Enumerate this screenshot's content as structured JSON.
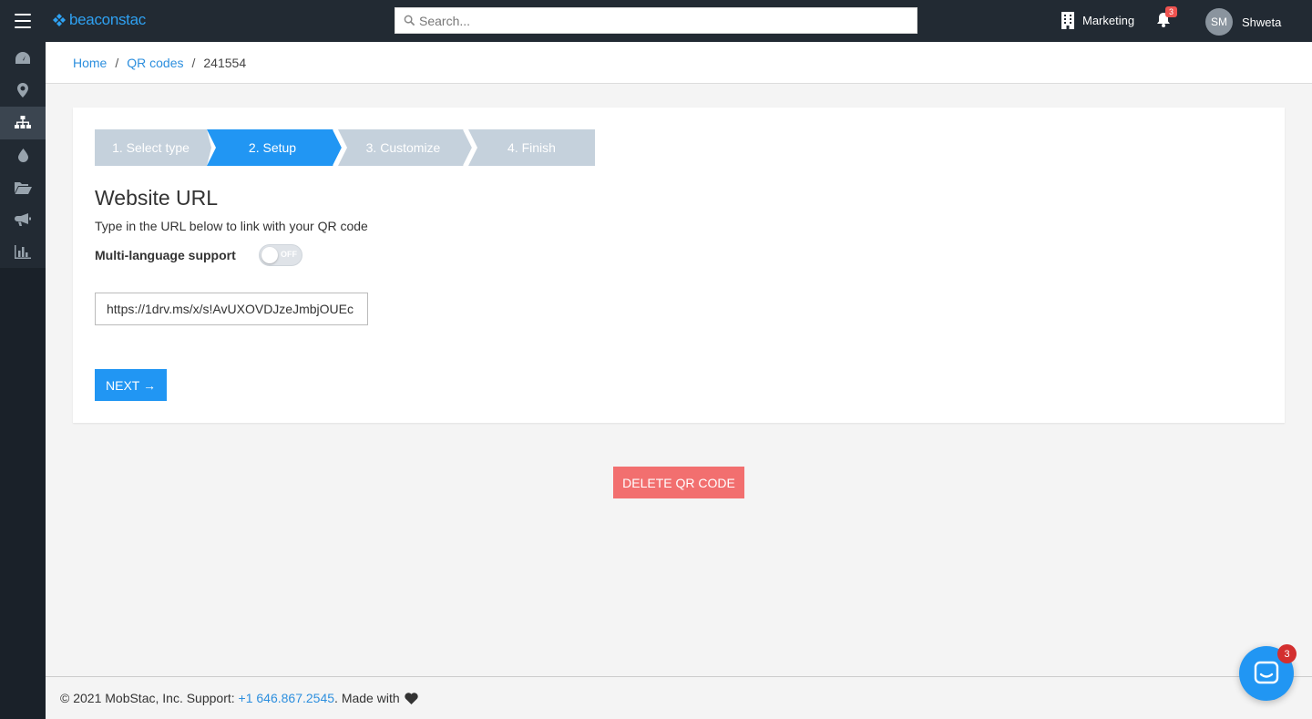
{
  "topbar": {
    "logo_text": "beaconstac",
    "search_placeholder": "Search...",
    "org_name": "Marketing",
    "notification_count": "3",
    "user_initials": "SM",
    "user_name": "Shweta"
  },
  "sidebar": {
    "items": [
      {
        "icon": "dashboard-icon"
      },
      {
        "icon": "location-pin-icon"
      },
      {
        "icon": "sitemap-icon",
        "active": true
      },
      {
        "icon": "drop-icon"
      },
      {
        "icon": "folder-open-icon"
      },
      {
        "icon": "megaphone-icon"
      },
      {
        "icon": "bar-chart-icon"
      },
      {
        "icon": "gears-icon"
      }
    ]
  },
  "breadcrumb": {
    "home": "Home",
    "qr_codes": "QR codes",
    "current": "241554",
    "separator": "/"
  },
  "wizard": {
    "steps": [
      {
        "label": "1. Select type",
        "state": "inactive"
      },
      {
        "label": "2. Setup",
        "state": "active"
      },
      {
        "label": "3. Customize",
        "state": "inactive"
      },
      {
        "label": "4. Finish",
        "state": "inactive"
      }
    ]
  },
  "form": {
    "title": "Website URL",
    "description": "Type in the URL below to link with your QR code",
    "multilang_label": "Multi-language support",
    "toggle_text": "OFF",
    "url_value": "https://1drv.ms/x/s!AvUXOVDJzeJmbjOUEc",
    "next_label": "NEXT →"
  },
  "delete_label": "DELETE QR CODE",
  "footer": {
    "copyright": "© 2021 MobStac, Inc. Support: ",
    "phone": "+1 646.867.2545",
    "made_with": ". Made with"
  },
  "chat": {
    "badge": "3"
  },
  "colors": {
    "topbar": "#222a33",
    "accent": "#2196f3",
    "step_inactive": "#c5d1dc",
    "delete": "#f26f6f"
  }
}
